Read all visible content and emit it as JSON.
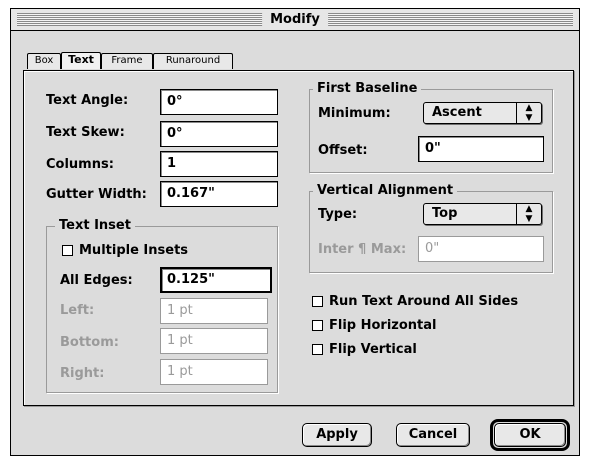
{
  "window": {
    "title": "Modify"
  },
  "tabs": [
    {
      "label": "Box"
    },
    {
      "label": "Text"
    },
    {
      "label": "Frame"
    },
    {
      "label": "Runaround"
    }
  ],
  "text_settings": {
    "text_angle_label": "Text Angle:",
    "text_angle_value": "0°",
    "text_skew_label": "Text Skew:",
    "text_skew_value": "0°",
    "columns_label": "Columns:",
    "columns_value": "1",
    "gutter_width_label": "Gutter Width:",
    "gutter_width_value": "0.167\""
  },
  "text_inset": {
    "title": "Text Inset",
    "multiple_insets_label": "Multiple Insets",
    "all_edges_label": "All Edges:",
    "all_edges_value": "0.125\"",
    "left_label": "Left:",
    "left_value": "1 pt",
    "bottom_label": "Bottom:",
    "bottom_value": "1 pt",
    "right_label": "Right:",
    "right_value": "1 pt"
  },
  "first_baseline": {
    "title": "First Baseline",
    "minimum_label": "Minimum:",
    "minimum_value": "Ascent",
    "offset_label": "Offset:",
    "offset_value": "0\""
  },
  "vertical_alignment": {
    "title": "Vertical Alignment",
    "type_label": "Type:",
    "type_value": "Top",
    "inter_max_label": "Inter ¶ Max:",
    "inter_max_value": "0\""
  },
  "options": {
    "run_text_around": "Run Text Around All Sides",
    "flip_horizontal": "Flip Horizontal",
    "flip_vertical": "Flip Vertical"
  },
  "buttons": {
    "apply": "Apply",
    "cancel": "Cancel",
    "ok": "OK"
  },
  "icons": {
    "popup_arrows": "up-down-arrows-icon"
  }
}
